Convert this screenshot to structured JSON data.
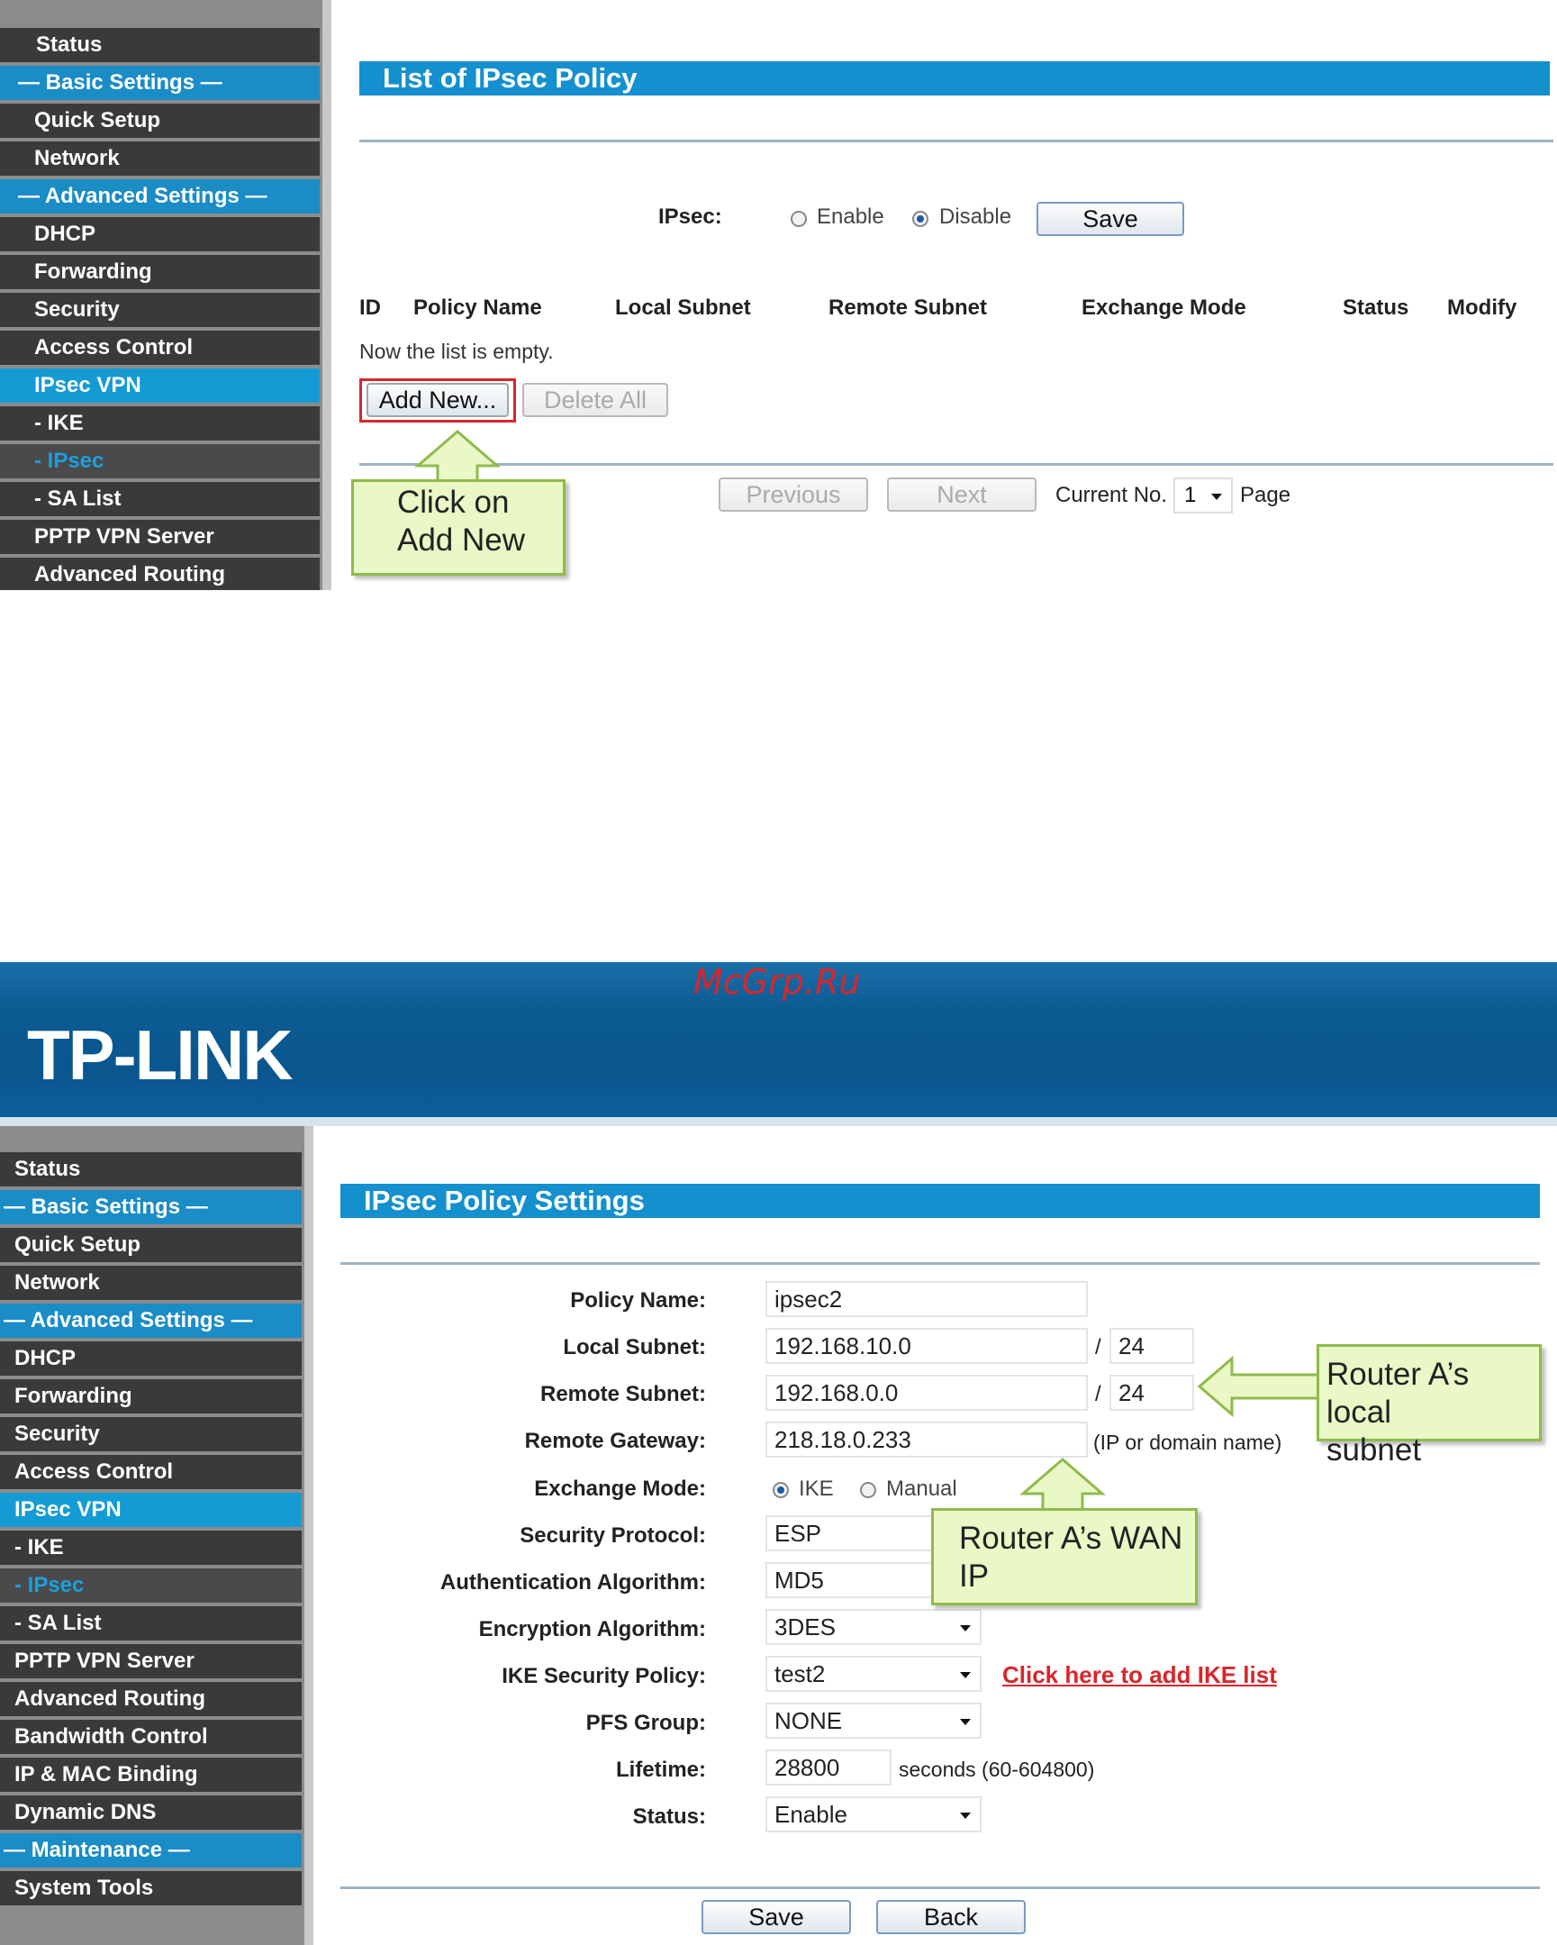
{
  "watermark": "McGrp.Ru",
  "logo": "TP-LINK",
  "panel1": {
    "sidebar": [
      "Status",
      "— Basic Settings —",
      "Quick Setup",
      "Network",
      "— Advanced Settings —",
      "DHCP",
      "Forwarding",
      "Security",
      "Access Control",
      "IPsec VPN",
      "- IKE",
      "- IPsec",
      "- SA List",
      "PPTP VPN Server",
      "Advanced Routing"
    ],
    "title": "List of IPsec Policy",
    "ipsec_label": "IPsec:",
    "enable_label": "Enable",
    "disable_label": "Disable",
    "save": "Save",
    "columns": [
      "ID",
      "Policy Name",
      "Local Subnet",
      "Remote Subnet",
      "Exchange Mode",
      "Status",
      "Modify"
    ],
    "empty_text": "Now the list is empty.",
    "add_new": "Add New...",
    "delete_all": "Delete All",
    "previous": "Previous",
    "next": "Next",
    "current_no": "Current No.",
    "page_value": "1",
    "page": "Page",
    "callout": [
      "Click on",
      "Add New"
    ]
  },
  "panel2": {
    "sidebar": [
      "Status",
      "— Basic Settings —",
      "Quick Setup",
      "Network",
      "— Advanced Settings —",
      "DHCP",
      "Forwarding",
      "Security",
      "Access Control",
      "IPsec VPN",
      "- IKE",
      "- IPsec",
      "- SA List",
      "PPTP VPN Server",
      "Advanced Routing",
      "Bandwidth Control",
      "IP & MAC Binding",
      "Dynamic DNS",
      "— Maintenance —",
      "System Tools"
    ],
    "title": "IPsec Policy Settings",
    "labels": {
      "policy_name": "Policy Name:",
      "local_subnet": "Local Subnet:",
      "remote_subnet": "Remote Subnet:",
      "remote_gateway": "Remote Gateway:",
      "exchange_mode": "Exchange Mode:",
      "security_protocol": "Security Protocol:",
      "auth_algorithm": "Authentication Algorithm:",
      "enc_algorithm": "Encryption Algorithm:",
      "ike_policy": "IKE Security Policy:",
      "pfs_group": "PFS Group:",
      "lifetime": "Lifetime:",
      "status": "Status:"
    },
    "values": {
      "policy_name": "ipsec2",
      "local_subnet": "192.168.10.0",
      "local_mask": "24",
      "remote_subnet": "192.168.0.0",
      "remote_mask": "24",
      "remote_gateway": "218.18.0.233",
      "gateway_hint": "(IP or domain name)",
      "mode_ike": "IKE",
      "mode_manual": "Manual",
      "security_protocol": "ESP",
      "auth_algorithm": "MD5",
      "enc_algorithm": "3DES",
      "ike_policy": "test2",
      "ike_link": "Click here to add IKE list",
      "pfs_group": "NONE",
      "lifetime": "28800",
      "lifetime_hint": "seconds (60-604800)",
      "status": "Enable",
      "slash": "/"
    },
    "save": "Save",
    "back": "Back",
    "callout_local": [
      "Router A’s local",
      "subnet"
    ],
    "callout_wan": [
      "Router A’s WAN",
      "IP"
    ]
  }
}
